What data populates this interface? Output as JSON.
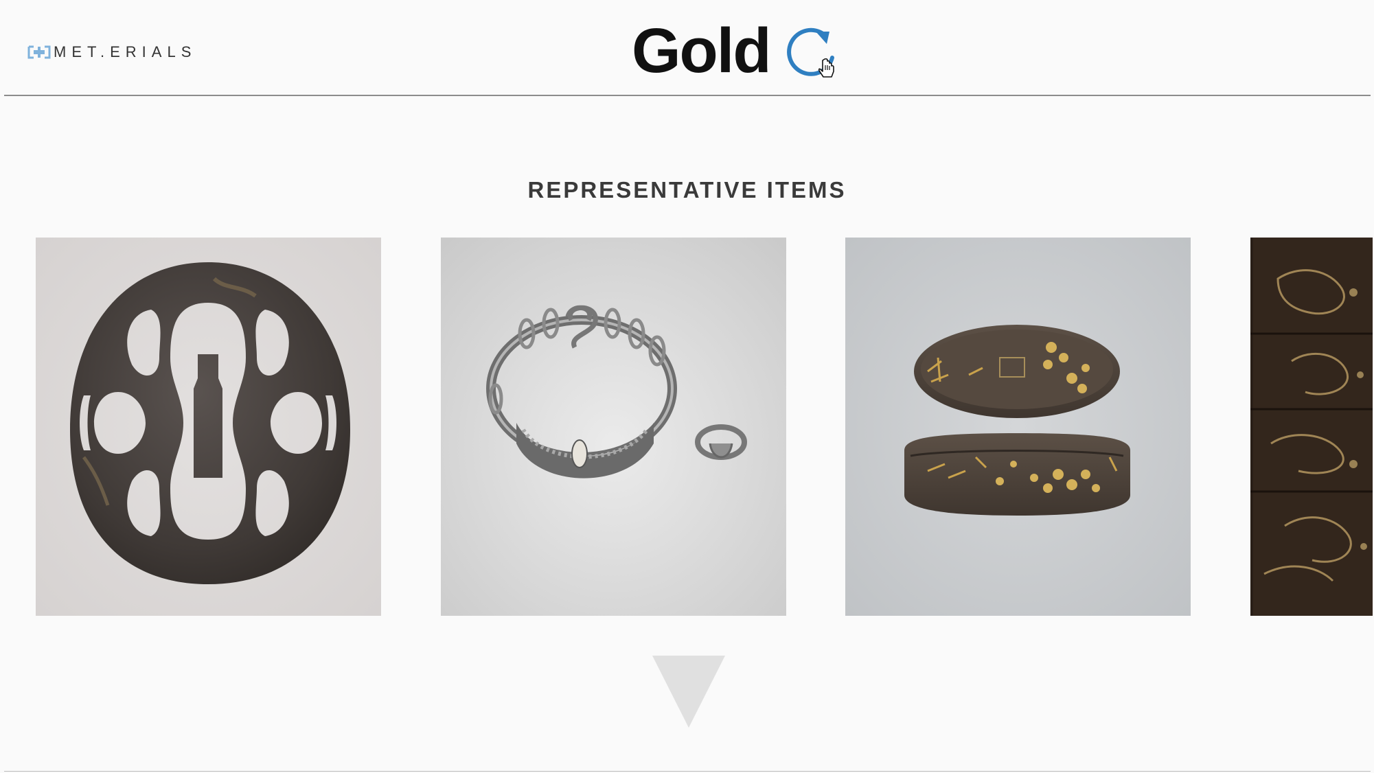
{
  "header": {
    "logo_text": "MET.ERIALS",
    "logo_icon": "logo-bracket-icon",
    "title": "Gold",
    "refresh_icon": "refresh-icon",
    "accent_color": "#2f7fc1"
  },
  "section": {
    "title": "REPRESENTATIVE ITEMS"
  },
  "items": [
    {
      "name": "tsuba-sword-guard",
      "icon": "image-icon"
    },
    {
      "name": "bracelet-and-ring",
      "icon": "image-icon"
    },
    {
      "name": "fuchi-kashira-set",
      "icon": "image-icon"
    },
    {
      "name": "inro-lacquer-case",
      "icon": "image-icon"
    }
  ],
  "navigation": {
    "down_icon": "triangle-down-icon"
  }
}
